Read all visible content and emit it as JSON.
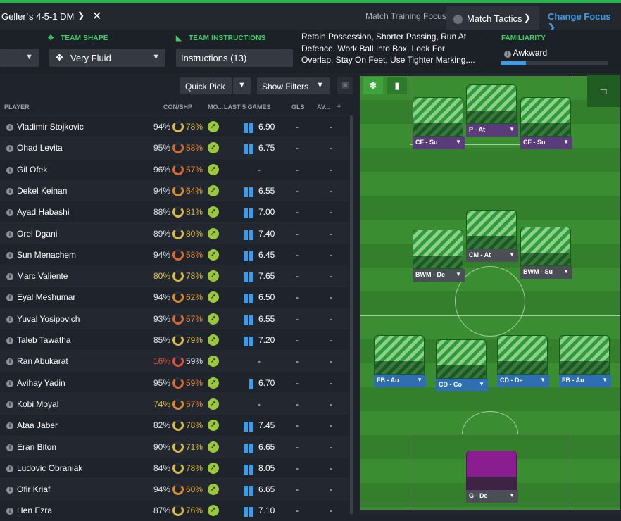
{
  "topbar": {
    "tactic_name": "Geller`s 4-5-1 DM",
    "match_training_focus": "Match Training Focus",
    "match_tactics": "Match Tactics",
    "change_focus": "Change Focus ❯"
  },
  "settings": {
    "team_shape_label": "TEAM SHAPE",
    "team_shape_value": "Very Fluid",
    "team_instructions_label": "TEAM INSTRUCTIONS",
    "team_instructions_value": "Instructions (13)",
    "instructions_text": "Retain Possession, Shorter Passing, Run At Defence, Work Ball Into Box, Look For Overlap, Stay On Feet, Use Tighter Marking,...",
    "familiarity_label": "FAMILIARITY",
    "familiarity_value": "Awkward",
    "familiarity_level": 0.23
  },
  "toolbar": {
    "quick_pick": "Quick Pick",
    "show_filters": "Show Filters"
  },
  "columns": {
    "player": "PLAYER",
    "con_shp": "CON/SHP",
    "morale": "MO...",
    "last5": "LAST 5 GAMES",
    "gls": "GLS",
    "av": "AV..."
  },
  "players": [
    {
      "name": "Vladimir Stojkovic",
      "con": "94%",
      "shp": "78%",
      "bars": 2,
      "rating": "6.90",
      "gls": "-",
      "av": "-",
      "con_color": "#dfe3e8",
      "shp_color": "#d9b94a",
      "ring_color": "#d9b94a"
    },
    {
      "name": "Ohad Levita",
      "con": "95%",
      "shp": "58%",
      "bars": 2,
      "rating": "6.75",
      "gls": "-",
      "av": "-",
      "con_color": "#dfe3e8",
      "shp_color": "#e8873a",
      "ring_color": "#d96a2f"
    },
    {
      "name": "Gil Ofek",
      "con": "96%",
      "shp": "57%",
      "bars": 0,
      "rating": "-",
      "gls": "-",
      "av": "-",
      "con_color": "#dfe3e8",
      "shp_color": "#e8873a",
      "ring_color": "#d96a2f"
    },
    {
      "name": "Dekel Keinan",
      "con": "94%",
      "shp": "64%",
      "bars": 2,
      "rating": "6.55",
      "gls": "-",
      "av": "-",
      "con_color": "#dfe3e8",
      "shp_color": "#e8a33a",
      "ring_color": "#d98a2f"
    },
    {
      "name": "Ayad Habashi",
      "con": "88%",
      "shp": "81%",
      "bars": 2,
      "rating": "7.00",
      "gls": "-",
      "av": "-",
      "con_color": "#dfe3e8",
      "shp_color": "#d9b94a",
      "ring_color": "#d9b94a"
    },
    {
      "name": "Orel Dgani",
      "con": "89%",
      "shp": "80%",
      "bars": 2,
      "rating": "7.40",
      "gls": "-",
      "av": "-",
      "con_color": "#dfe3e8",
      "shp_color": "#d9b94a",
      "ring_color": "#d9b94a"
    },
    {
      "name": "Sun Menachem",
      "con": "94%",
      "shp": "58%",
      "bars": 2,
      "rating": "6.45",
      "gls": "-",
      "av": "-",
      "con_color": "#dfe3e8",
      "shp_color": "#e8873a",
      "ring_color": "#d96a2f"
    },
    {
      "name": "Marc Valiente",
      "con": "80%",
      "shp": "78%",
      "bars": 2,
      "rating": "7.65",
      "gls": "-",
      "av": "-",
      "con_color": "#e8c14a",
      "shp_color": "#d9b94a",
      "ring_color": "#d9b94a"
    },
    {
      "name": "Eyal Meshumar",
      "con": "94%",
      "shp": "62%",
      "bars": 2,
      "rating": "6.50",
      "gls": "-",
      "av": "-",
      "con_color": "#dfe3e8",
      "shp_color": "#e8a33a",
      "ring_color": "#d98a2f"
    },
    {
      "name": "Yuval Yosipovich",
      "con": "93%",
      "shp": "57%",
      "bars": 2,
      "rating": "6.55",
      "gls": "-",
      "av": "-",
      "con_color": "#dfe3e8",
      "shp_color": "#e8873a",
      "ring_color": "#d96a2f"
    },
    {
      "name": "Taleb Tawatha",
      "con": "85%",
      "shp": "79%",
      "bars": 2,
      "rating": "7.20",
      "gls": "-",
      "av": "-",
      "con_color": "#dfe3e8",
      "shp_color": "#d9b94a",
      "ring_color": "#d9b94a"
    },
    {
      "name": "Ran Abukarat",
      "con": "16%",
      "shp": "59%",
      "bars": 0,
      "rating": "-",
      "gls": "-",
      "av": "-",
      "con_color": "#e0503a",
      "shp_color": "#dfe3e8",
      "ring_color": "#e0503a"
    },
    {
      "name": "Avihay Yadin",
      "con": "95%",
      "shp": "59%",
      "bars": 1,
      "rating": "6.70",
      "gls": "-",
      "av": "-",
      "con_color": "#dfe3e8",
      "shp_color": "#e8873a",
      "ring_color": "#d96a2f"
    },
    {
      "name": "Kobi Moyal",
      "con": "74%",
      "shp": "57%",
      "bars": 0,
      "rating": "-",
      "gls": "-",
      "av": "-",
      "con_color": "#e8c14a",
      "shp_color": "#e8873a",
      "ring_color": "#d98a2f"
    },
    {
      "name": "Ataa Jaber",
      "con": "82%",
      "shp": "78%",
      "bars": 2,
      "rating": "7.45",
      "gls": "-",
      "av": "-",
      "con_color": "#dfe3e8",
      "shp_color": "#d9b94a",
      "ring_color": "#d9b94a"
    },
    {
      "name": "Eran Biton",
      "con": "90%",
      "shp": "71%",
      "bars": 2,
      "rating": "6.65",
      "gls": "-",
      "av": "-",
      "con_color": "#dfe3e8",
      "shp_color": "#d9b94a",
      "ring_color": "#d9b94a"
    },
    {
      "name": "Ludovic Obraniak",
      "con": "84%",
      "shp": "78%",
      "bars": 2,
      "rating": "8.05",
      "gls": "-",
      "av": "-",
      "con_color": "#dfe3e8",
      "shp_color": "#d9b94a",
      "ring_color": "#d9b94a"
    },
    {
      "name": "Ofir Kriaf",
      "con": "94%",
      "shp": "60%",
      "bars": 2,
      "rating": "6.65",
      "gls": "-",
      "av": "-",
      "con_color": "#dfe3e8",
      "shp_color": "#e8a33a",
      "ring_color": "#d98a2f"
    },
    {
      "name": "Hen Ezra",
      "con": "87%",
      "shp": "76%",
      "bars": 2,
      "rating": "7.10",
      "gls": "-",
      "av": "-",
      "con_color": "#dfe3e8",
      "shp_color": "#d9b94a",
      "ring_color": "#d9b94a"
    }
  ],
  "positions": [
    {
      "role": "CF - Su",
      "type": "fw"
    },
    {
      "role": "P - At",
      "type": "fw"
    },
    {
      "role": "CF - Su",
      "type": "fw"
    },
    {
      "role": "BWM - De",
      "type": "mf"
    },
    {
      "role": "CM - At",
      "type": "mf"
    },
    {
      "role": "BWM - Su",
      "type": "mf"
    },
    {
      "role": "FB - Au",
      "type": "df"
    },
    {
      "role": "CD - Co",
      "type": "df"
    },
    {
      "role": "CD - De",
      "type": "df"
    },
    {
      "role": "FB - Au",
      "type": "df"
    },
    {
      "role": "G - De",
      "type": "gk"
    }
  ],
  "colors": {
    "accent": "#2bb24c",
    "link": "#3d9be8",
    "pitch": "#3b8d32"
  }
}
